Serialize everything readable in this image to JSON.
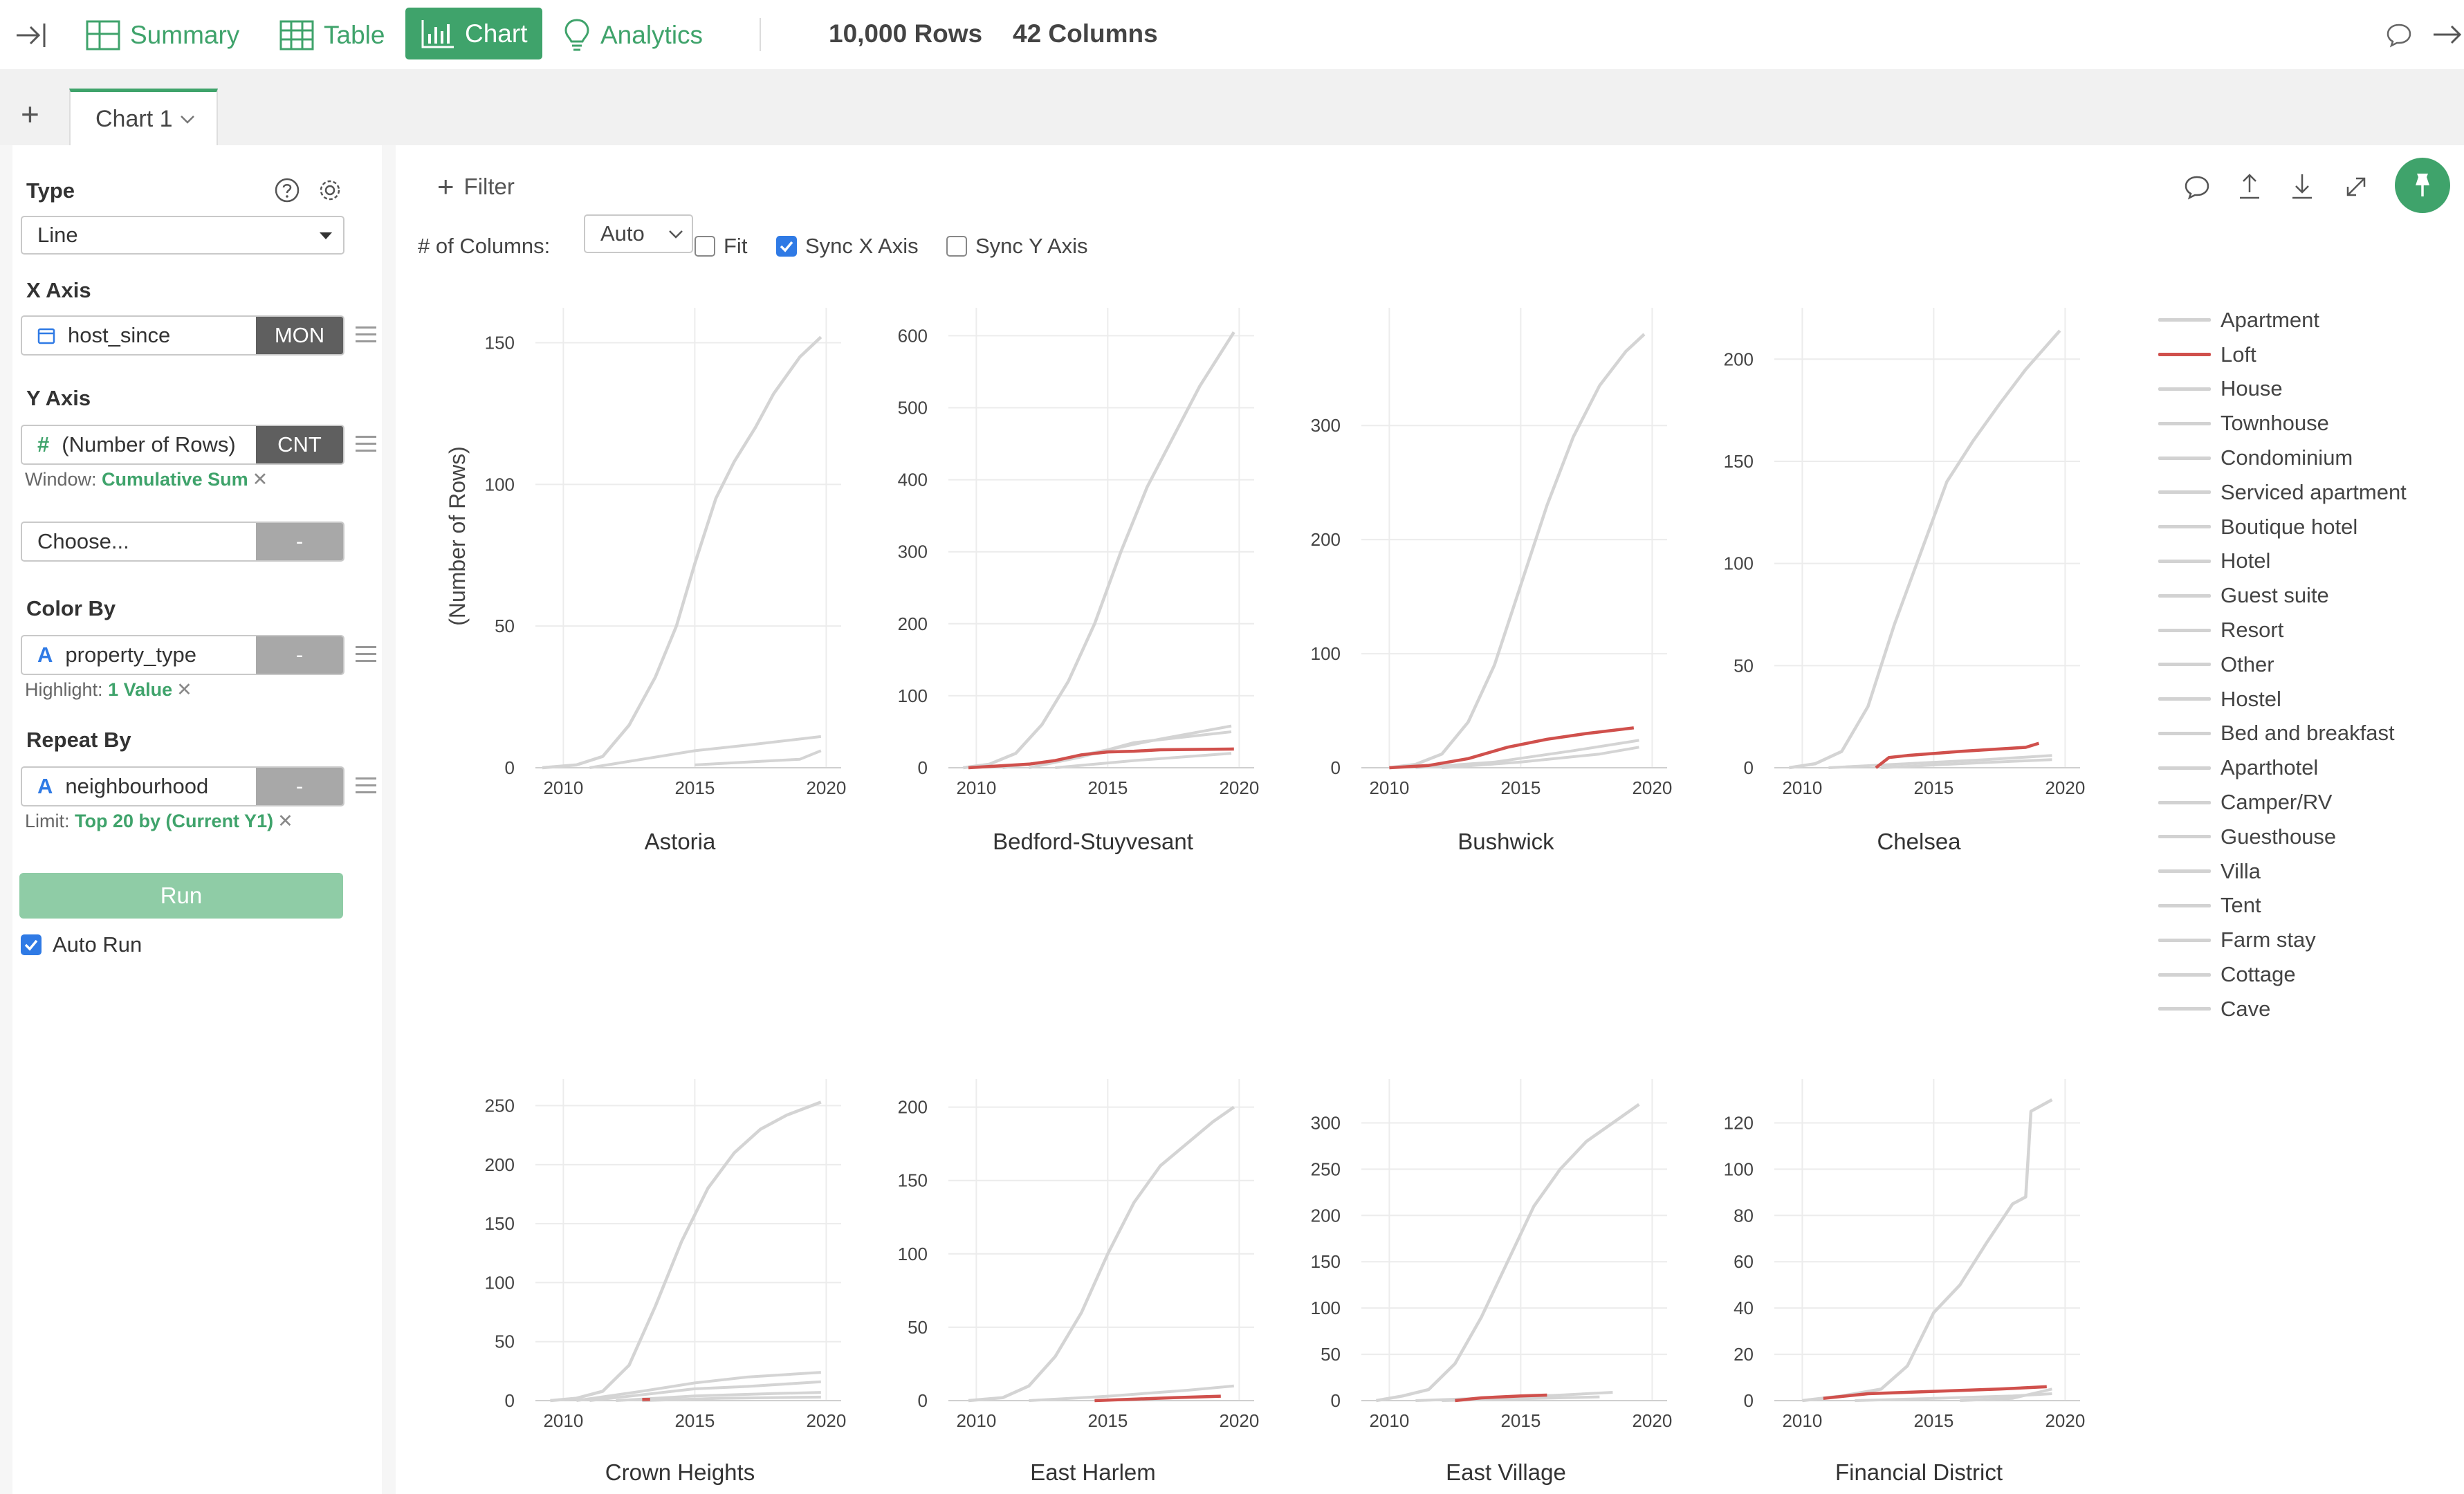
{
  "nav": {
    "items": [
      {
        "label": "Summary",
        "icon": "summary-icon"
      },
      {
        "label": "Table",
        "icon": "table-icon"
      },
      {
        "label": "Chart",
        "icon": "bar-chart-icon",
        "active": true
      },
      {
        "label": "Analytics",
        "icon": "lightbulb-icon"
      }
    ],
    "rows": "10,000 Rows",
    "columns": "42 Columns"
  },
  "tabs": {
    "add": "+",
    "items": [
      {
        "label": "Chart 1"
      }
    ]
  },
  "config": {
    "type": {
      "label": "Type",
      "value": "Line"
    },
    "x_axis": {
      "label": "X Axis",
      "field": "host_since",
      "agg": "MON"
    },
    "y_axis": {
      "label": "Y Axis",
      "field": "(Number of Rows)",
      "agg": "CNT",
      "window_label": "Window:",
      "window_value": "Cumulative Sum"
    },
    "y_axis_extra": {
      "placeholder": "Choose...",
      "agg": "-"
    },
    "color_by": {
      "label": "Color By",
      "field": "property_type",
      "agg": "-",
      "highlight_label": "Highlight:",
      "highlight_value": "1 Value"
    },
    "repeat_by": {
      "label": "Repeat By",
      "field": "neighbourhood",
      "agg": "-",
      "limit_label": "Limit:",
      "limit_value": "Top 20 by (Current Y1)"
    },
    "run": "Run",
    "auto_run": "Auto Run"
  },
  "toolbar": {
    "filter": "Filter",
    "columns_label": "# of Columns:",
    "columns_value": "Auto",
    "fit": "Fit",
    "sync_x": "Sync X Axis",
    "sync_y": "Sync Y Axis"
  },
  "colors": {
    "accent": "#3fa36b",
    "highlight": "#d0504c",
    "others": "#d4d4d4",
    "arrow": "#e8416a"
  },
  "chart_data": {
    "type": "line",
    "ylabel": "(Number of Rows)",
    "x_ticks": [
      2010,
      2015,
      2020
    ],
    "series_names": [
      "Apartment",
      "Loft",
      "House",
      "Townhouse",
      "Condominium",
      "Serviced apartment",
      "Boutique hotel",
      "Hotel",
      "Guest suite",
      "Resort",
      "Other",
      "Hostel",
      "Bed and breakfast",
      "Aparthotel",
      "Camper/RV",
      "Guesthouse",
      "Villa",
      "Tent",
      "Farm stay",
      "Cottage",
      "Cave"
    ],
    "highlight_series": "Loft",
    "facets": [
      {
        "title": "Astoria",
        "ylim": [
          0,
          155
        ],
        "yticks": [
          0,
          50,
          100,
          150
        ],
        "apartment": [
          [
            2009.2,
            0
          ],
          [
            2010.5,
            1
          ],
          [
            2011.5,
            4
          ],
          [
            2012.5,
            15
          ],
          [
            2013.5,
            32
          ],
          [
            2014.3,
            50
          ],
          [
            2015,
            72
          ],
          [
            2015.8,
            95
          ],
          [
            2016.5,
            108
          ],
          [
            2017.3,
            120
          ],
          [
            2018,
            132
          ],
          [
            2019,
            145
          ],
          [
            2019.8,
            152
          ]
        ],
        "loft": [],
        "others": [
          [
            [
              2011,
              0
            ],
            [
              2013,
              3
            ],
            [
              2015,
              6
            ],
            [
              2017,
              8
            ],
            [
              2019.8,
              11
            ]
          ],
          [
            [
              2015,
              1
            ],
            [
              2017,
              2
            ],
            [
              2019,
              3
            ],
            [
              2019.8,
              6
            ]
          ]
        ]
      },
      {
        "title": "Bedford-Stuyvesant",
        "ylim": [
          0,
          610
        ],
        "yticks": [
          0,
          100,
          200,
          300,
          400,
          500,
          600
        ],
        "apartment": [
          [
            2009.5,
            0
          ],
          [
            2010.5,
            5
          ],
          [
            2011.5,
            20
          ],
          [
            2012.5,
            60
          ],
          [
            2013.5,
            120
          ],
          [
            2014.5,
            200
          ],
          [
            2015.5,
            300
          ],
          [
            2016.5,
            390
          ],
          [
            2017.5,
            460
          ],
          [
            2018.5,
            530
          ],
          [
            2019.8,
            605
          ]
        ],
        "loft": [
          [
            2009.7,
            0
          ],
          [
            2012,
            5
          ],
          [
            2013,
            10
          ],
          [
            2014,
            18
          ],
          [
            2015,
            22
          ],
          [
            2016,
            23
          ],
          [
            2017,
            25
          ],
          [
            2019.8,
            26
          ]
        ],
        "others": [
          [
            [
              2011,
              0
            ],
            [
              2013,
              10
            ],
            [
              2015,
              25
            ],
            [
              2017,
              40
            ],
            [
              2019.7,
              58
            ]
          ],
          [
            [
              2012,
              0
            ],
            [
              2014,
              15
            ],
            [
              2016,
              35
            ],
            [
              2019.7,
              50
            ]
          ],
          [
            [
              2013,
              0
            ],
            [
              2016,
              10
            ],
            [
              2019.7,
              20
            ]
          ]
        ]
      },
      {
        "title": "Bushwick",
        "ylim": [
          0,
          385
        ],
        "yticks": [
          0,
          100,
          200,
          300
        ],
        "apartment": [
          [
            2010,
            0
          ],
          [
            2011,
            3
          ],
          [
            2012,
            12
          ],
          [
            2013,
            40
          ],
          [
            2014,
            90
          ],
          [
            2015,
            160
          ],
          [
            2016,
            230
          ],
          [
            2017,
            290
          ],
          [
            2018,
            335
          ],
          [
            2019,
            365
          ],
          [
            2019.7,
            380
          ]
        ],
        "loft": [
          [
            2010,
            0
          ],
          [
            2011.5,
            2
          ],
          [
            2013,
            8
          ],
          [
            2014.5,
            18
          ],
          [
            2016,
            25
          ],
          [
            2017.5,
            30
          ],
          [
            2019.3,
            35
          ]
        ],
        "others": [
          [
            [
              2011,
              0
            ],
            [
              2014,
              5
            ],
            [
              2017,
              15
            ],
            [
              2019.5,
              24
            ]
          ],
          [
            [
              2012,
              0
            ],
            [
              2015,
              5
            ],
            [
              2018,
              12
            ],
            [
              2019.5,
              18
            ]
          ]
        ]
      },
      {
        "title": "Chelsea",
        "ylim": [
          0,
          215
        ],
        "yticks": [
          0,
          50,
          100,
          150,
          200
        ],
        "apartment": [
          [
            2009.5,
            0
          ],
          [
            2010.5,
            2
          ],
          [
            2011.5,
            8
          ],
          [
            2012.5,
            30
          ],
          [
            2013.5,
            70
          ],
          [
            2014.5,
            105
          ],
          [
            2015.5,
            140
          ],
          [
            2016.5,
            160
          ],
          [
            2017.5,
            178
          ],
          [
            2018.5,
            195
          ],
          [
            2019.8,
            214
          ]
        ],
        "loft": [
          [
            2012.8,
            0
          ],
          [
            2013.3,
            5
          ],
          [
            2014,
            6
          ],
          [
            2016,
            8
          ],
          [
            2018.5,
            10
          ],
          [
            2019,
            12
          ]
        ],
        "others": [
          [
            [
              2011,
              0
            ],
            [
              2014,
              2
            ],
            [
              2017,
              4
            ],
            [
              2019.5,
              6
            ]
          ],
          [
            [
              2013,
              0
            ],
            [
              2016,
              2
            ],
            [
              2019.5,
              4
            ]
          ]
        ]
      },
      {
        "title": "Crown Heights",
        "ylim": [
          0,
          255
        ],
        "yticks": [
          0,
          50,
          100,
          150,
          200,
          250
        ],
        "apartment": [
          [
            2009.5,
            0
          ],
          [
            2010.5,
            2
          ],
          [
            2011.5,
            8
          ],
          [
            2012.5,
            30
          ],
          [
            2013.5,
            80
          ],
          [
            2014.5,
            135
          ],
          [
            2015.5,
            180
          ],
          [
            2016.5,
            210
          ],
          [
            2017.5,
            230
          ],
          [
            2018.5,
            242
          ],
          [
            2019.8,
            253
          ]
        ],
        "loft": [
          [
            2013,
            1
          ],
          [
            2013.3,
            1
          ]
        ],
        "others": [
          [
            [
              2010.5,
              0
            ],
            [
              2013,
              8
            ],
            [
              2015,
              15
            ],
            [
              2017,
              20
            ],
            [
              2019.8,
              24
            ]
          ],
          [
            [
              2011,
              0
            ],
            [
              2013,
              5
            ],
            [
              2015,
              10
            ],
            [
              2017,
              12
            ],
            [
              2019.8,
              16
            ]
          ],
          [
            [
              2012,
              0
            ],
            [
              2015,
              4
            ],
            [
              2018,
              6
            ],
            [
              2019.8,
              7
            ]
          ],
          [
            [
              2013,
              0
            ],
            [
              2016,
              2
            ],
            [
              2019.8,
              3
            ]
          ]
        ]
      },
      {
        "title": "East Harlem",
        "ylim": [
          0,
          205
        ],
        "yticks": [
          0,
          50,
          100,
          150,
          200
        ],
        "apartment": [
          [
            2009.7,
            0
          ],
          [
            2011,
            2
          ],
          [
            2012,
            10
          ],
          [
            2013,
            30
          ],
          [
            2014,
            60
          ],
          [
            2015,
            100
          ],
          [
            2016,
            135
          ],
          [
            2017,
            160
          ],
          [
            2018,
            175
          ],
          [
            2019,
            190
          ],
          [
            2019.8,
            200
          ]
        ],
        "loft": [
          [
            2014.5,
            0
          ],
          [
            2016,
            1
          ],
          [
            2017.5,
            2
          ],
          [
            2019.3,
            3
          ]
        ],
        "others": [
          [
            [
              2012,
              0
            ],
            [
              2015,
              3
            ],
            [
              2018,
              7
            ],
            [
              2019.8,
              10
            ]
          ]
        ]
      },
      {
        "title": "East Village",
        "ylim": [
          0,
          325
        ],
        "yticks": [
          0,
          50,
          100,
          150,
          200,
          250,
          300
        ],
        "apartment": [
          [
            2009.5,
            0
          ],
          [
            2010.5,
            5
          ],
          [
            2011.5,
            12
          ],
          [
            2012.5,
            40
          ],
          [
            2013.5,
            90
          ],
          [
            2014.5,
            150
          ],
          [
            2015.5,
            210
          ],
          [
            2016.5,
            250
          ],
          [
            2017.5,
            280
          ],
          [
            2018.5,
            300
          ],
          [
            2019.5,
            320
          ]
        ],
        "loft": [
          [
            2012.5,
            0
          ],
          [
            2013.5,
            3
          ],
          [
            2015,
            5
          ],
          [
            2016,
            6
          ]
        ],
        "others": [
          [
            [
              2011,
              0
            ],
            [
              2014,
              3
            ],
            [
              2016.5,
              6
            ],
            [
              2018.5,
              9
            ]
          ],
          [
            [
              2012,
              0
            ],
            [
              2015,
              2
            ],
            [
              2018,
              4
            ]
          ]
        ]
      },
      {
        "title": "Financial District",
        "ylim": [
          0,
          130
        ],
        "yticks": [
          0,
          20,
          40,
          60,
          80,
          100,
          120
        ],
        "apartment": [
          [
            2010,
            0
          ],
          [
            2011.5,
            2
          ],
          [
            2013,
            5
          ],
          [
            2014,
            15
          ],
          [
            2015,
            38
          ],
          [
            2016,
            50
          ],
          [
            2017,
            68
          ],
          [
            2018,
            85
          ],
          [
            2018.5,
            88
          ],
          [
            2018.7,
            125
          ],
          [
            2019.5,
            130
          ]
        ],
        "loft": [
          [
            2010.8,
            1
          ],
          [
            2012.5,
            3
          ],
          [
            2015,
            4
          ],
          [
            2017.5,
            5
          ],
          [
            2019.3,
            6
          ]
        ],
        "others": [
          [
            [
              2012,
              0
            ],
            [
              2015,
              1
            ],
            [
              2018,
              2
            ],
            [
              2019.5,
              3
            ]
          ],
          [
            [
              2016,
              0
            ],
            [
              2018,
              1
            ],
            [
              2019.5,
              5
            ]
          ]
        ]
      }
    ]
  }
}
